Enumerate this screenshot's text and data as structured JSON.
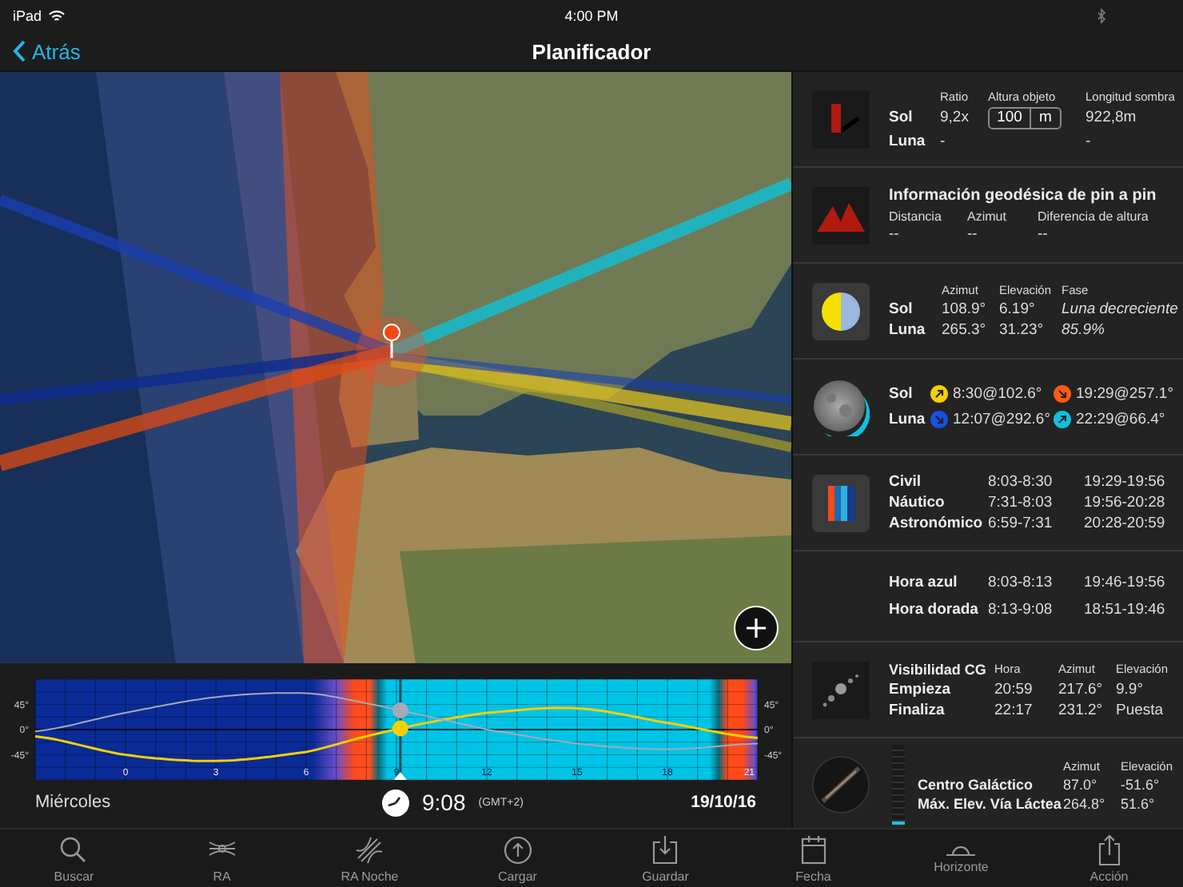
{
  "status_bar": {
    "device": "iPad",
    "time": "4:00 PM"
  },
  "nav": {
    "back": "Atrás",
    "title": "Planificador"
  },
  "timeline": {
    "chart_data": {
      "type": "line",
      "x": [
        -3,
        0,
        3,
        6,
        8,
        10,
        12,
        15,
        18,
        21
      ],
      "series": [
        {
          "color": "#f5d000",
          "values": [
            -12,
            -45,
            -56,
            -40,
            -12,
            12,
            30,
            38,
            12,
            -15
          ]
        },
        {
          "color": "#a8a8b8",
          "values": [
            -3,
            30,
            58,
            65,
            47,
            24,
            0,
            -25,
            -35,
            -25
          ]
        }
      ],
      "xlim": [
        -3,
        21
      ],
      "ylim": [
        -90,
        90
      ],
      "xticks": [
        0,
        3,
        6,
        9,
        12,
        15,
        18,
        21
      ],
      "yticks": [
        {
          "value": 45,
          "label": "45°"
        },
        {
          "value": 0,
          "label": "0°"
        },
        {
          "value": -45,
          "label": "-45°"
        }
      ],
      "ref_lines": [
        {
          "axis": "x",
          "value": 9.13
        }
      ],
      "grid": true
    },
    "day": "Miércoles",
    "time": "9:08",
    "zone": "(GMT+2)",
    "date": "19/10/16"
  },
  "panels": [
    {
      "kind": "shadow",
      "labels": [
        "Sol",
        "Luna"
      ],
      "columns": [
        {
          "header": "Ratio",
          "values": [
            "9,2x",
            "-"
          ]
        },
        {
          "header": "Altura objeto",
          "kind": "input",
          "value": "100",
          "unit": "m"
        },
        {
          "header": "Longitud sombra",
          "values": [
            "922,8m",
            "-"
          ]
        }
      ]
    },
    {
      "kind": "geodesic",
      "title": "Información geodésica de pin a pin",
      "columns": [
        {
          "header": "Distancia",
          "values": [
            "--"
          ]
        },
        {
          "header": "Azimut",
          "values": [
            "--"
          ]
        },
        {
          "header": "Diferencia de altura",
          "values": [
            "--"
          ]
        }
      ]
    },
    {
      "kind": "phase",
      "labels": [
        "Sol",
        "Luna"
      ],
      "columns": [
        {
          "header": "Azimut",
          "values": [
            "108.9°",
            "265.3°"
          ]
        },
        {
          "header": "Elevación",
          "values": [
            "6.19°",
            "31.23°"
          ]
        },
        {
          "header": "Fase",
          "kind": "italic",
          "values": [
            "Luna decreciente",
            "85.9%"
          ]
        }
      ]
    },
    {
      "kind": "riseset",
      "labels": [
        "Sol",
        "Luna"
      ],
      "columns": [
        {
          "kind": "event",
          "values": [
            {
              "text": "8:30@102.6°",
              "color": "#f5d000",
              "kind": "rise"
            },
            {
              "text": "12:07@292.6°",
              "color": "#1a4fe0",
              "kind": "set"
            }
          ]
        },
        {
          "kind": "event",
          "values": [
            {
              "text": "19:29@257.1°",
              "color": "#ff5a10",
              "kind": "set"
            },
            {
              "text": "22:29@66.4°",
              "color": "#10c0e0",
              "kind": "rise"
            }
          ]
        }
      ]
    },
    {
      "kind": "twilight",
      "labels": [
        "Civil",
        "Náutico",
        "Astronómico"
      ],
      "columns": [
        {
          "values": [
            "8:03-8:30",
            "7:31-8:03",
            "6:59-7:31"
          ]
        },
        {
          "values": [
            "19:29-19:56",
            "19:56-20:28",
            "20:28-20:59"
          ]
        }
      ]
    },
    {
      "kind": "hours",
      "labels": [
        "Hora azul",
        "Hora dorada"
      ],
      "columns": [
        {
          "values": [
            "8:03-8:13",
            "8:13-9:08"
          ]
        },
        {
          "values": [
            "19:46-19:56",
            "18:51-19:46"
          ]
        }
      ]
    },
    {
      "kind": "galactic_visibility",
      "label_header": "Visibilidad CG",
      "labels": [
        "Empieza",
        "Finaliza"
      ],
      "columns": [
        {
          "header": "Hora",
          "values": [
            "20:59",
            "22:17"
          ]
        },
        {
          "header": "Azimut",
          "values": [
            "217.6°",
            "231.2°"
          ]
        },
        {
          "header": "Elevación",
          "values": [
            "9.9°",
            "Puesta"
          ]
        }
      ]
    },
    {
      "kind": "galactic_center",
      "level": 0.05,
      "labels": [
        "Centro Galáctico",
        "Máx. Elev. Vía Láctea"
      ],
      "columns": [
        {
          "header": "Azimut",
          "values": [
            "87.0°",
            "264.8°"
          ]
        },
        {
          "header": "Elevación",
          "values": [
            "-51.6°",
            "51.6°"
          ]
        }
      ]
    }
  ],
  "tab_bar": [
    {
      "label": "Buscar"
    },
    {
      "label": "RA"
    },
    {
      "label": "RA Noche"
    },
    {
      "label": "Cargar"
    },
    {
      "label": "Guardar"
    },
    {
      "label": "Fecha"
    },
    {
      "label": "Horizonte"
    },
    {
      "label": "Acción"
    }
  ]
}
